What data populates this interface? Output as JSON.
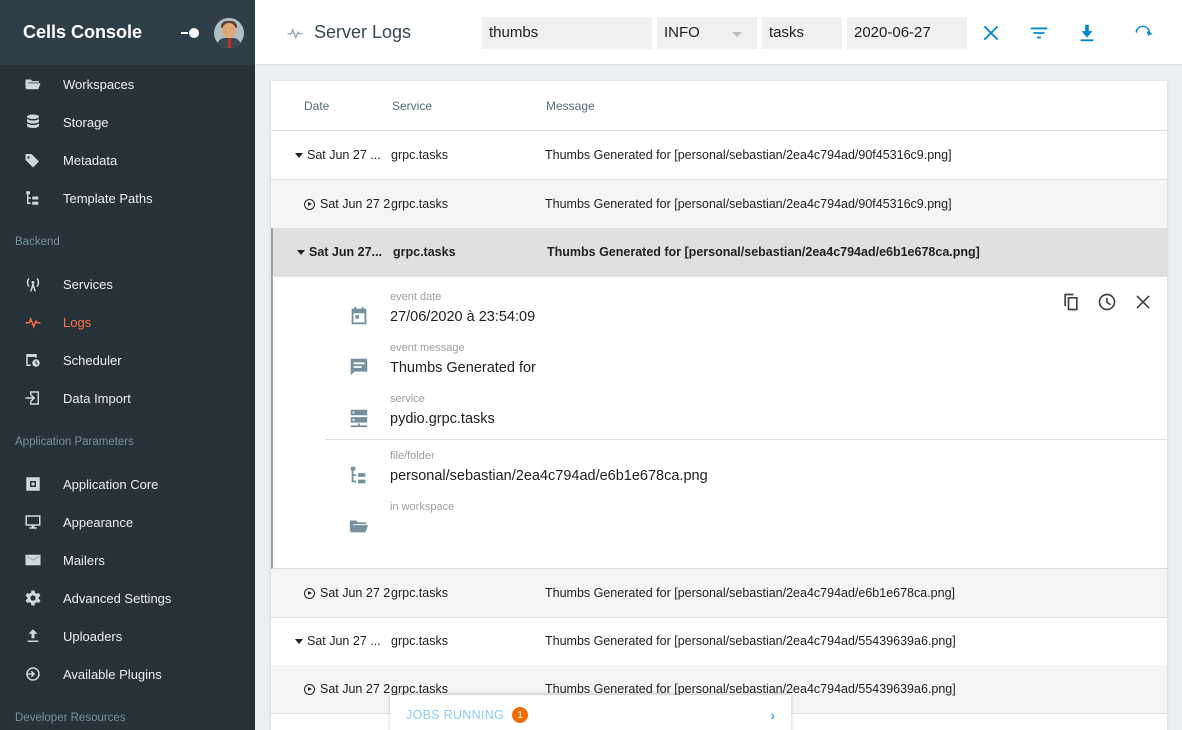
{
  "sidebar": {
    "title": "Cells Console",
    "items": [
      {
        "label": "Workspaces",
        "icon": "folder-open-icon"
      },
      {
        "label": "Storage",
        "icon": "database-icon"
      },
      {
        "label": "Metadata",
        "icon": "tags-icon"
      },
      {
        "label": "Template Paths",
        "icon": "file-tree-icon"
      },
      {
        "label": "Services",
        "icon": "antenna-icon"
      },
      {
        "label": "Logs",
        "icon": "pulse-icon",
        "active": true
      },
      {
        "label": "Scheduler",
        "icon": "calendar-clock-icon"
      },
      {
        "label": "Data Import",
        "icon": "import-icon"
      },
      {
        "label": "Application Core",
        "icon": "core-icon"
      },
      {
        "label": "Appearance",
        "icon": "monitor-icon"
      },
      {
        "label": "Mailers",
        "icon": "email-icon"
      },
      {
        "label": "Advanced Settings",
        "icon": "gear-icon"
      },
      {
        "label": "Uploaders",
        "icon": "upload-icon"
      },
      {
        "label": "Available Plugins",
        "icon": "plugin-icon"
      }
    ],
    "sections": {
      "backend": "Backend",
      "app_params": "Application Parameters",
      "dev_resources": "Developer Resources"
    }
  },
  "header": {
    "title": "Server Logs",
    "filters": {
      "query": "thumbs",
      "level": "INFO",
      "service": "tasks",
      "date": "2020-06-27"
    }
  },
  "table": {
    "columns": {
      "date": "Date",
      "service": "Service",
      "message": "Message"
    },
    "rows": [
      {
        "date": "Sat Jun 27 ...",
        "service": "grpc.tasks",
        "message": "Thumbs Generated for [personal/sebastian/2ea4c794ad/90f45316c9.png]"
      },
      {
        "date": "Sat Jun 27 2",
        "service": "grpc.tasks",
        "message": "Thumbs Generated for [personal/sebastian/2ea4c794ad/90f45316c9.png]"
      },
      {
        "date": "Sat Jun 27...",
        "service": "grpc.tasks",
        "message": "Thumbs Generated for [personal/sebastian/2ea4c794ad/e6b1e678ca.png]"
      },
      {
        "date": "Sat Jun 27 2",
        "service": "grpc.tasks",
        "message": "Thumbs Generated for [personal/sebastian/2ea4c794ad/e6b1e678ca.png]"
      },
      {
        "date": "Sat Jun 27 ...",
        "service": "grpc.tasks",
        "message": "Thumbs Generated for [personal/sebastian/2ea4c794ad/55439639a6.png]"
      },
      {
        "date": "Sat Jun 27 2",
        "service": "grpc.tasks",
        "message": "Thumbs Generated for [personal/sebastian/2ea4c794ad/55439639a6.png]"
      }
    ]
  },
  "detail": {
    "event_date_label": "event date",
    "event_date": "27/06/2020 à 23:54:09",
    "event_message_label": "event message",
    "event_message": "Thumbs Generated for",
    "service_label": "service",
    "service": "pydio.grpc.tasks",
    "file_label": "file/folder",
    "file": "personal/sebastian/2ea4c794ad/e6b1e678ca.png",
    "workspace_label": "in workspace",
    "workspace": ""
  },
  "jobs": {
    "label": "JOBS RUNNING",
    "count": "1"
  },
  "colors": {
    "accent": "#0288d1",
    "active_nav": "#ff7043",
    "sidebar_bg": "#263238",
    "badge": "#ef6c00"
  }
}
